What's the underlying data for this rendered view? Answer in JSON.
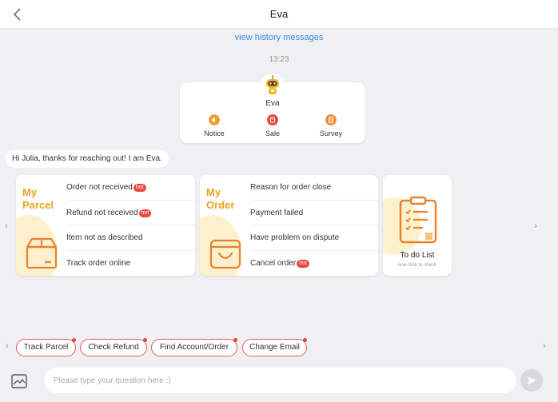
{
  "header": {
    "title": "Eva"
  },
  "history_link": "view history messages",
  "timestamp": "13:23",
  "bot": {
    "name": "Eva",
    "actions": [
      {
        "label": "Notice",
        "color": "#f0a033",
        "icon": "megaphone-icon"
      },
      {
        "label": "Sale",
        "color": "#e8463f",
        "icon": "sale-tag-icon"
      },
      {
        "label": "Survey",
        "color": "#f08a33",
        "icon": "survey-icon"
      }
    ]
  },
  "greeting": "Hi Julia, thanks for reaching out! I am Eva.",
  "parcel_card": {
    "title_line1": "My",
    "title_line2": "Parcel",
    "items": [
      {
        "label": "Order not received",
        "hot": "hot"
      },
      {
        "label": "Refund not received",
        "hot": "hot"
      },
      {
        "label": "Item not as described",
        "hot": ""
      },
      {
        "label": "Track order online",
        "hot": ""
      }
    ]
  },
  "order_card": {
    "title_line1": "My",
    "title_line2": "Order",
    "items": [
      {
        "label": "Reason for order close",
        "hot": ""
      },
      {
        "label": "Payment failed",
        "hot": ""
      },
      {
        "label": "Have problem on dispute",
        "hot": ""
      },
      {
        "label": "Cancel order",
        "hot": "hot"
      }
    ]
  },
  "todo_card": {
    "title": "To do List",
    "subtitle": "one-click to check"
  },
  "quick_replies": [
    "Track Parcel",
    "Check Refund",
    "Find Account/Order",
    "Change Email"
  ],
  "composer": {
    "placeholder": "Please type your question here :)"
  },
  "colors": {
    "accent": "#e8a41f",
    "icon_orange": "#e8832f",
    "hot": "#e8463f",
    "chip_border": "#e45b55",
    "link": "#3b8beb"
  }
}
